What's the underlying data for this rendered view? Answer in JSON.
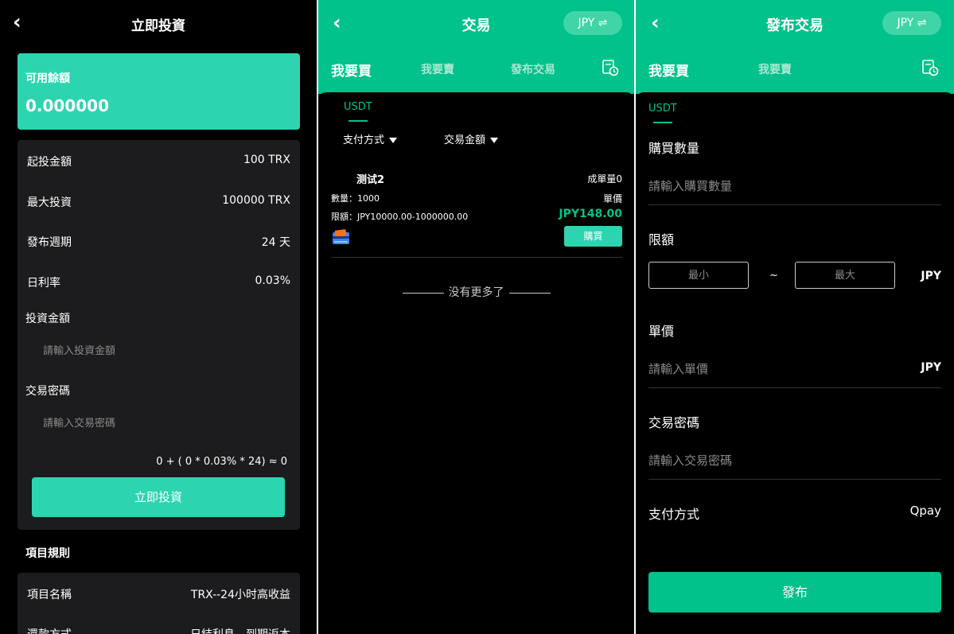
{
  "invest": {
    "title": "立即投資",
    "balance_label": "可用餘額",
    "balance_value": "0.000000",
    "rows": [
      {
        "label": "起投金額",
        "value": "100 TRX"
      },
      {
        "label": "最大投資",
        "value": "100000 TRX"
      },
      {
        "label": "發布週期",
        "value": "24 天"
      },
      {
        "label": "日利率",
        "value": "0.03%"
      }
    ],
    "amount_label": "投資金額",
    "amount_placeholder": "請輸入投資金額",
    "password_label": "交易密碼",
    "password_placeholder": "請輸入交易密碼",
    "formula": "0 + ( 0 * 0.03% * 24) ≈ 0",
    "button": "立即投資",
    "rules_title": "項目規則",
    "rules": [
      {
        "label": "項目名稱",
        "value": "TRX--24小时高收益"
      },
      {
        "label": "還款方式",
        "value": "日結利息，到期返本"
      }
    ],
    "accent": "#2dd4b0"
  },
  "trade": {
    "title": "交易",
    "currency": "JPY ⇌",
    "tabs": [
      {
        "label": "我要買",
        "active": true
      },
      {
        "label": "我要賣",
        "active": false
      },
      {
        "label": "發布交易",
        "active": false
      }
    ],
    "coin_tab": "USDT",
    "filters": [
      "支付方式",
      "交易金額"
    ],
    "listing": {
      "name": "测试2",
      "volume": "成單量0",
      "quantity": "數量：1000",
      "unit_price_label": "單價",
      "limit": "限額：JPY10000.00-1000000.00",
      "price": "JPY148.00",
      "buy_button": "購買",
      "payment_icon": "card-icon"
    },
    "no_more": "没有更多了",
    "accent": "#00c28a"
  },
  "publish": {
    "title": "發布交易",
    "currency": "JPY ⇌",
    "tabs": [
      {
        "label": "我要買",
        "active": true
      },
      {
        "label": "我要賣",
        "active": false
      }
    ],
    "coin_tab": "USDT",
    "qty_label": "購買數量",
    "qty_placeholder": "請輸入購買數量",
    "limit_label": "限額",
    "min_placeholder": "最小",
    "tilde": "~",
    "max_placeholder": "最大",
    "limit_unit": "JPY",
    "price_label": "單價",
    "price_placeholder": "請輸入單價",
    "price_unit": "JPY",
    "password_label": "交易密碼",
    "password_placeholder": "請輸入交易密碼",
    "payment_label": "支付方式",
    "payment_value": "Qpay",
    "button": "發布"
  }
}
